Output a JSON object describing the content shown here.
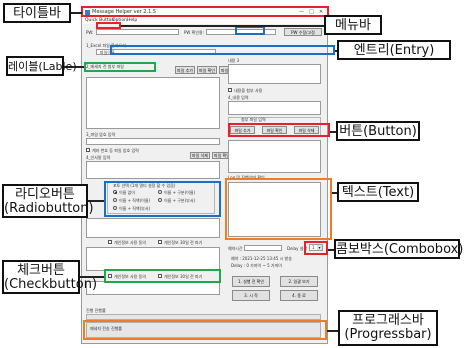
{
  "window": {
    "title": "Message Helper ver 2.1.5",
    "controls": {
      "minimize": "—",
      "maximize": "□",
      "close": "✕"
    }
  },
  "menu": {
    "items": [
      "Quick Button",
      "Option",
      "Help"
    ]
  },
  "top": {
    "pw_label": "PW:",
    "pw_confirm_label": "PW 확인용:",
    "pw_edit_button": "PW 수정/고정"
  },
  "left": {
    "excel_label": "1_Excel 파일 불러오기",
    "excel_filename": "파일이름",
    "send_title": "2_메세지 전 첨부 파일",
    "btn_add": "파일 추가",
    "btn_view": "파일 확인",
    "btn_delete": "파일 삭제",
    "file_pw_label": "3_파일 암호 입력",
    "chk_file_pw": "계좌 번호 등 파일 암호 입력",
    "tree_msg_label": "나중에 첨부",
    "mobile_label": "4_인사말 입력",
    "btn_file_check": "파일 삭제",
    "btn_file_view2": "파일 확인",
    "delay_frame_title": "포토 선택 (1개 멀티 설정 할 수 있음)",
    "radios": [
      {
        "label": "이름 없이",
        "checked": true
      },
      {
        "label": "이름 + 구분(이름)",
        "checked": false
      },
      {
        "label": "이름 + 직책(이름)",
        "checked": false
      },
      {
        "label": "이름 + 구분(부서)",
        "checked": false
      },
      {
        "label": "이름 + 직책(부서)",
        "checked": false
      }
    ],
    "chk_opt_a": "개인정보 사용 동의",
    "chk_opt_b": "개인정보 30일 전 파기",
    "chk_opt_c": "개인정보 사용 동의",
    "chk_opt_d": "개인정보 30일 전 파기",
    "greeting_label": "5_인사말 입력"
  },
  "right": {
    "content_label": "내용 3",
    "chk_content": "내용을 첨부 사용",
    "content2_label": "4_내용 입력",
    "attach_frame_title": "첨부 파일 입력",
    "btn_add": "파일 추가",
    "btn_view": "파일 확인",
    "btn_delete": "파일 삭제",
    "log_label": "Log 및 진행상태 확인",
    "delay_label": "Delay 설정",
    "delay_value": "1",
    "schedule_label": "예약시간",
    "info_line1": "예약 : 2021-12-25 13:45 시 발송",
    "info_line2": "Delay : 0 가까이 ~ 5 가까이",
    "btn_send_now": "1. 실행 전 확인",
    "btn_schedule": "2. 일괄 보기",
    "btn_start": "3. 시 작",
    "btn_stop": "4. 종 료"
  },
  "bottom": {
    "progress_label": "진행 진행률",
    "status_text": "메세지 전송 진행률",
    "progress": 0
  },
  "annotations": {
    "title_bar": "타이틀바",
    "menu_bar": "메뉴바",
    "entry": "엔트리(Entry)",
    "label": "레이블(Lable)",
    "button": "버튼(Button)",
    "radiobutton": [
      "라디오버튼",
      "(Radiobutton)"
    ],
    "text": "텍스트(Text)",
    "combobox": "콤보박스(Combobox)",
    "checkbutton": [
      "체크버튼",
      "(Checkbutton)"
    ],
    "progressbar": [
      "프로그래스바",
      "(Progressbar)"
    ]
  },
  "colors": {
    "red": "#e8202a",
    "orange": "#ee7d2a",
    "blue": "#1b6fc2",
    "green": "#22a84a"
  }
}
